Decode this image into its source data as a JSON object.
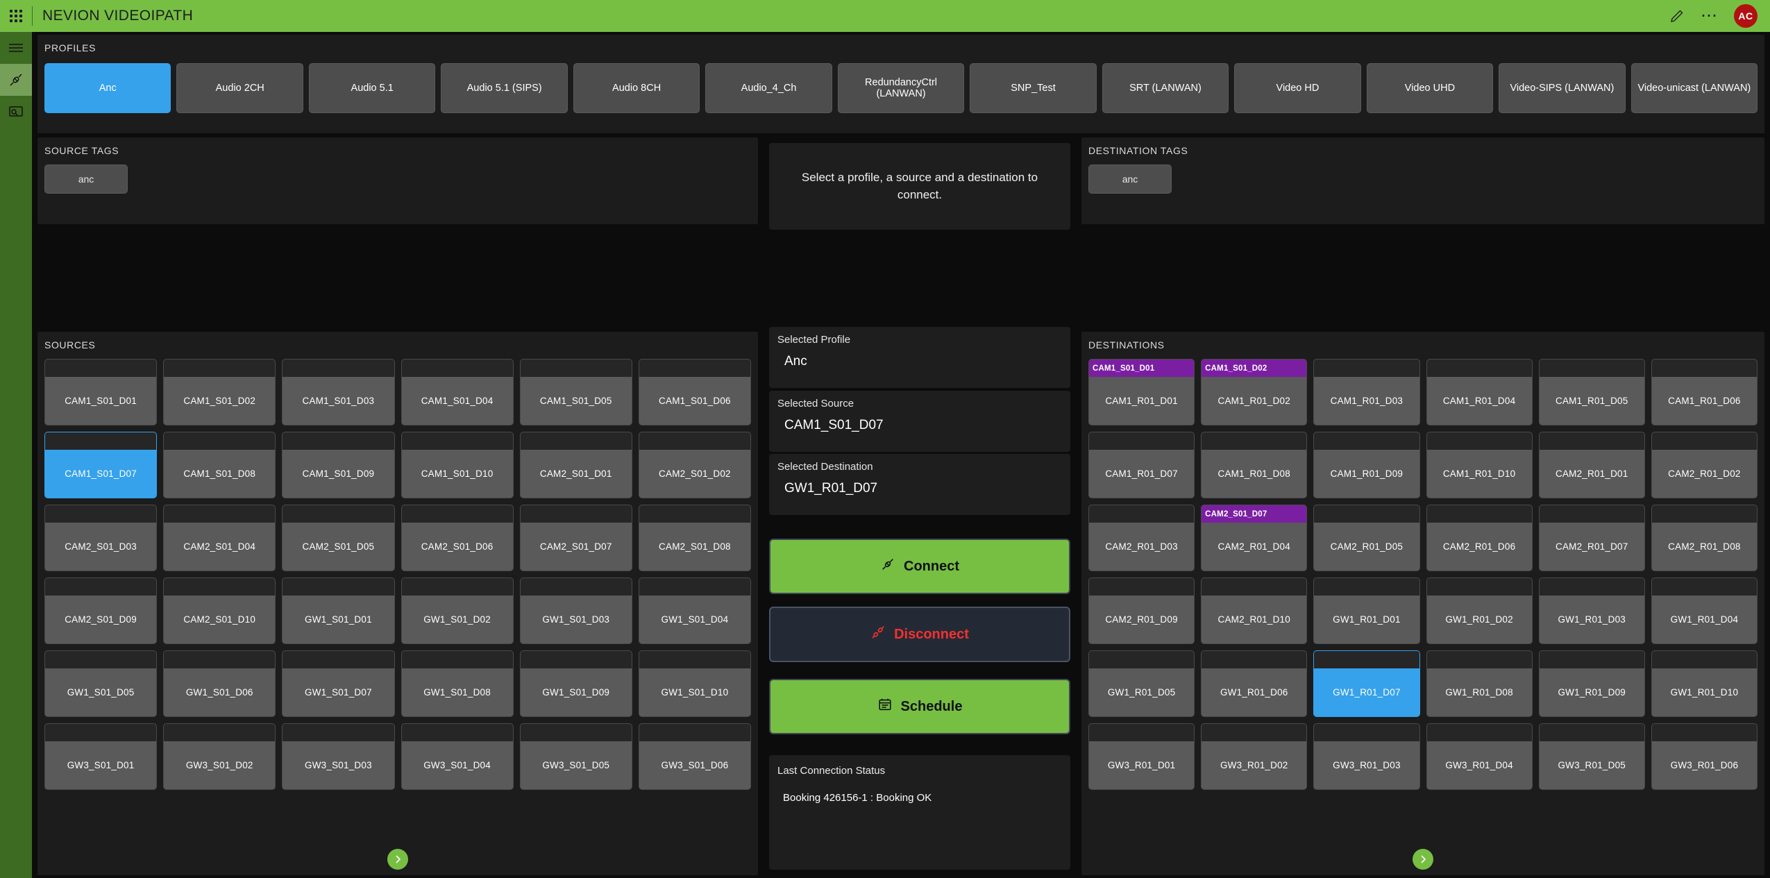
{
  "app": {
    "title": "NEVION VIDEOIPATH",
    "avatar_initials": "AC",
    "accent_green": "#76bf43",
    "accent_blue": "#36a2eb",
    "tag_purple": "#7b1fa2",
    "disconnect_red": "#f4312f"
  },
  "rail": {
    "items": [
      {
        "name": "menu-icon"
      },
      {
        "name": "connections-icon"
      },
      {
        "name": "monitor-icon"
      }
    ]
  },
  "profiles": {
    "title": "PROFILES",
    "selected": "Anc",
    "tabs": [
      "Anc",
      "Audio 2CH",
      "Audio 5.1",
      "Audio 5.1 (SIPS)",
      "Audio 8CH",
      "Audio_4_Ch",
      "RedundancyCtrl (LANWAN)",
      "SNP_Test",
      "SRT (LANWAN)",
      "Video HD",
      "Video UHD",
      "Video-SIPS (LANWAN)",
      "Video-unicast (LANWAN)"
    ]
  },
  "source_tags": {
    "title": "SOURCE TAGS",
    "tags": [
      "anc"
    ]
  },
  "destination_tags": {
    "title": "DESTINATION TAGS",
    "tags": [
      "anc"
    ]
  },
  "center": {
    "hint": "Select a profile, a source and a destination to connect.",
    "selected_profile_label": "Selected Profile",
    "selected_profile_value": "Anc",
    "selected_source_label": "Selected Source",
    "selected_source_value": "CAM1_S01_D07",
    "selected_destination_label": "Selected Destination",
    "selected_destination_value": "GW1_R01_D07",
    "connect_label": "Connect",
    "disconnect_label": "Disconnect",
    "schedule_label": "Schedule",
    "status_label": "Last Connection Status",
    "status_value": "Booking 426156-1 : Booking OK"
  },
  "sources": {
    "title": "SOURCES",
    "selected": "CAM1_S01_D07",
    "pager_next": "next-page",
    "tiles": [
      {
        "label": "CAM1_S01_D01",
        "tag": "",
        "selected": false
      },
      {
        "label": "CAM1_S01_D02",
        "tag": "",
        "selected": false
      },
      {
        "label": "CAM1_S01_D03",
        "tag": "",
        "selected": false
      },
      {
        "label": "CAM1_S01_D04",
        "tag": "",
        "selected": false
      },
      {
        "label": "CAM1_S01_D05",
        "tag": "",
        "selected": false
      },
      {
        "label": "CAM1_S01_D06",
        "tag": "",
        "selected": false
      },
      {
        "label": "CAM1_S01_D07",
        "tag": "",
        "selected": true
      },
      {
        "label": "CAM1_S01_D08",
        "tag": "",
        "selected": false
      },
      {
        "label": "CAM1_S01_D09",
        "tag": "",
        "selected": false
      },
      {
        "label": "CAM1_S01_D10",
        "tag": "",
        "selected": false
      },
      {
        "label": "CAM2_S01_D01",
        "tag": "",
        "selected": false
      },
      {
        "label": "CAM2_S01_D02",
        "tag": "",
        "selected": false
      },
      {
        "label": "CAM2_S01_D03",
        "tag": "",
        "selected": false
      },
      {
        "label": "CAM2_S01_D04",
        "tag": "",
        "selected": false
      },
      {
        "label": "CAM2_S01_D05",
        "tag": "",
        "selected": false
      },
      {
        "label": "CAM2_S01_D06",
        "tag": "",
        "selected": false
      },
      {
        "label": "CAM2_S01_D07",
        "tag": "",
        "selected": false
      },
      {
        "label": "CAM2_S01_D08",
        "tag": "",
        "selected": false
      },
      {
        "label": "CAM2_S01_D09",
        "tag": "",
        "selected": false
      },
      {
        "label": "CAM2_S01_D10",
        "tag": "",
        "selected": false
      },
      {
        "label": "GW1_S01_D01",
        "tag": "",
        "selected": false
      },
      {
        "label": "GW1_S01_D02",
        "tag": "",
        "selected": false
      },
      {
        "label": "GW1_S01_D03",
        "tag": "",
        "selected": false
      },
      {
        "label": "GW1_S01_D04",
        "tag": "",
        "selected": false
      },
      {
        "label": "GW1_S01_D05",
        "tag": "",
        "selected": false
      },
      {
        "label": "GW1_S01_D06",
        "tag": "",
        "selected": false
      },
      {
        "label": "GW1_S01_D07",
        "tag": "",
        "selected": false
      },
      {
        "label": "GW1_S01_D08",
        "tag": "",
        "selected": false
      },
      {
        "label": "GW1_S01_D09",
        "tag": "",
        "selected": false
      },
      {
        "label": "GW1_S01_D10",
        "tag": "",
        "selected": false
      },
      {
        "label": "GW3_S01_D01",
        "tag": "",
        "selected": false
      },
      {
        "label": "GW3_S01_D02",
        "tag": "",
        "selected": false
      },
      {
        "label": "GW3_S01_D03",
        "tag": "",
        "selected": false
      },
      {
        "label": "GW3_S01_D04",
        "tag": "",
        "selected": false
      },
      {
        "label": "GW3_S01_D05",
        "tag": "",
        "selected": false
      },
      {
        "label": "GW3_S01_D06",
        "tag": "",
        "selected": false
      }
    ]
  },
  "destinations": {
    "title": "DESTINATIONS",
    "selected": "GW1_R01_D07",
    "pager_next": "next-page",
    "tiles": [
      {
        "label": "CAM1_R01_D01",
        "tag": "CAM1_S01_D01",
        "selected": false
      },
      {
        "label": "CAM1_R01_D02",
        "tag": "CAM1_S01_D02",
        "selected": false
      },
      {
        "label": "CAM1_R01_D03",
        "tag": "",
        "selected": false
      },
      {
        "label": "CAM1_R01_D04",
        "tag": "",
        "selected": false
      },
      {
        "label": "CAM1_R01_D05",
        "tag": "",
        "selected": false
      },
      {
        "label": "CAM1_R01_D06",
        "tag": "",
        "selected": false
      },
      {
        "label": "CAM1_R01_D07",
        "tag": "",
        "selected": false
      },
      {
        "label": "CAM1_R01_D08",
        "tag": "",
        "selected": false
      },
      {
        "label": "CAM1_R01_D09",
        "tag": "",
        "selected": false
      },
      {
        "label": "CAM1_R01_D10",
        "tag": "",
        "selected": false
      },
      {
        "label": "CAM2_R01_D01",
        "tag": "",
        "selected": false
      },
      {
        "label": "CAM2_R01_D02",
        "tag": "",
        "selected": false
      },
      {
        "label": "CAM2_R01_D03",
        "tag": "",
        "selected": false
      },
      {
        "label": "CAM2_R01_D04",
        "tag": "CAM2_S01_D07",
        "selected": false
      },
      {
        "label": "CAM2_R01_D05",
        "tag": "",
        "selected": false
      },
      {
        "label": "CAM2_R01_D06",
        "tag": "",
        "selected": false
      },
      {
        "label": "CAM2_R01_D07",
        "tag": "",
        "selected": false
      },
      {
        "label": "CAM2_R01_D08",
        "tag": "",
        "selected": false
      },
      {
        "label": "CAM2_R01_D09",
        "tag": "",
        "selected": false
      },
      {
        "label": "CAM2_R01_D10",
        "tag": "",
        "selected": false
      },
      {
        "label": "GW1_R01_D01",
        "tag": "",
        "selected": false
      },
      {
        "label": "GW1_R01_D02",
        "tag": "",
        "selected": false
      },
      {
        "label": "GW1_R01_D03",
        "tag": "",
        "selected": false
      },
      {
        "label": "GW1_R01_D04",
        "tag": "",
        "selected": false
      },
      {
        "label": "GW1_R01_D05",
        "tag": "",
        "selected": false
      },
      {
        "label": "GW1_R01_D06",
        "tag": "",
        "selected": false
      },
      {
        "label": "GW1_R01_D07",
        "tag": "",
        "selected": true
      },
      {
        "label": "GW1_R01_D08",
        "tag": "",
        "selected": false
      },
      {
        "label": "GW1_R01_D09",
        "tag": "",
        "selected": false
      },
      {
        "label": "GW1_R01_D10",
        "tag": "",
        "selected": false
      },
      {
        "label": "GW3_R01_D01",
        "tag": "",
        "selected": false
      },
      {
        "label": "GW3_R01_D02",
        "tag": "",
        "selected": false
      },
      {
        "label": "GW3_R01_D03",
        "tag": "",
        "selected": false
      },
      {
        "label": "GW3_R01_D04",
        "tag": "",
        "selected": false
      },
      {
        "label": "GW3_R01_D05",
        "tag": "",
        "selected": false
      },
      {
        "label": "GW3_R01_D06",
        "tag": "",
        "selected": false
      }
    ]
  }
}
